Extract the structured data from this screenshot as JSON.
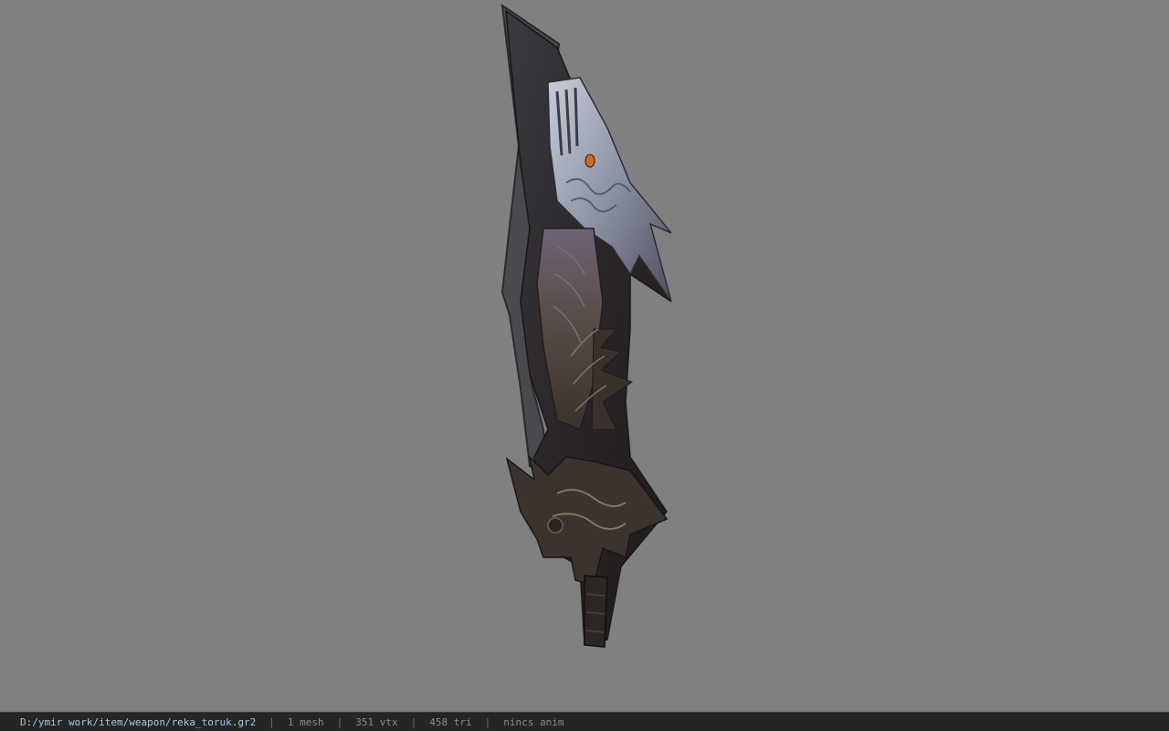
{
  "viewer": {
    "background_color": "#808080",
    "model_name": "reka_toruk",
    "model_icon": "dragon-blade-weapon"
  },
  "status_bar": {
    "file_path": "D:/ymir work/item/weapon/reka_toruk.gr2",
    "separator": "|",
    "mesh": "1 mesh",
    "vertices": "351 vtx",
    "triangles": "458 tri",
    "animation": "nincs anim"
  }
}
